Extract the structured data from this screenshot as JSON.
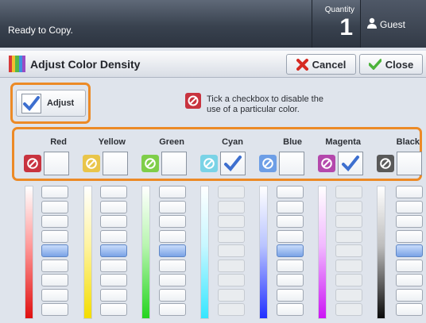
{
  "header": {
    "status": "Ready to Copy.",
    "quantity_label": "Quantity",
    "quantity_value": "1",
    "user": "Guest"
  },
  "titlebar": {
    "title": "Adjust Color Density",
    "cancel_label": "Cancel",
    "close_label": "Close"
  },
  "adjust": {
    "label": "Adjust",
    "checked": true
  },
  "hint": {
    "text": "Tick a checkbox to disable the use of a particular color."
  },
  "colors": {
    "accent": "#ec8a26",
    "selected_segment": "#7aa3e6"
  },
  "channels": [
    {
      "name": "Red",
      "icon_color": "#c8333f",
      "disabled": false,
      "level_step": 5
    },
    {
      "name": "Yellow",
      "icon_color": "#e9c54a",
      "disabled": false,
      "level_step": 5
    },
    {
      "name": "Green",
      "icon_color": "#7fce49",
      "disabled": false,
      "level_step": 5
    },
    {
      "name": "Cyan",
      "icon_color": "#7ad3e6",
      "disabled": true,
      "level_step": null
    },
    {
      "name": "Blue",
      "icon_color": "#6d9ee6",
      "disabled": false,
      "level_step": 5
    },
    {
      "name": "Magenta",
      "icon_color": "#b448ac",
      "disabled": true,
      "level_step": null
    },
    {
      "name": "Black",
      "icon_color": "#595959",
      "disabled": false,
      "level_step": 5
    }
  ],
  "slider_steps": 9
}
